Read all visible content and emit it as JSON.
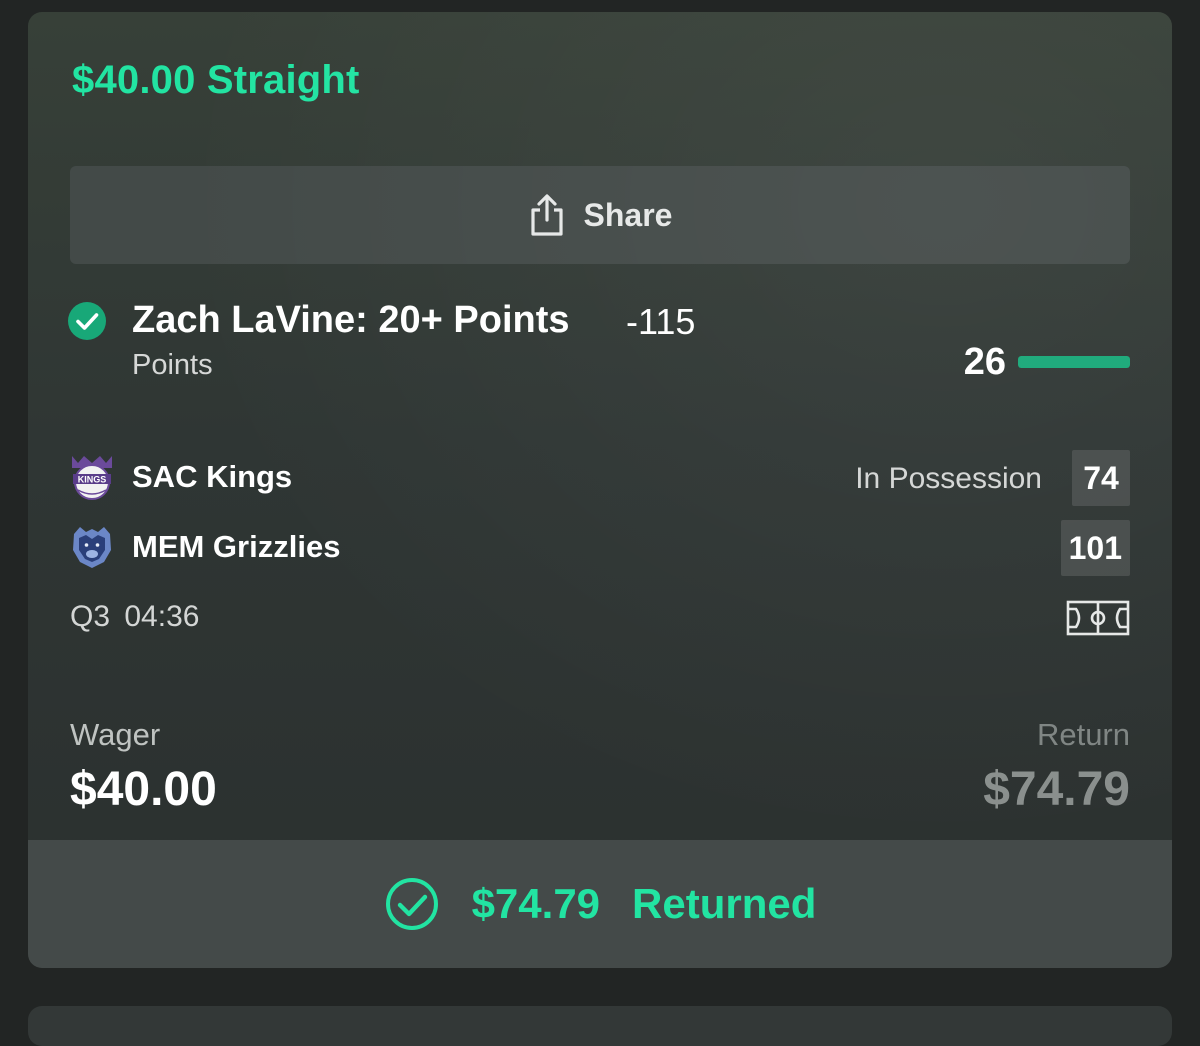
{
  "bet": {
    "title": "$40.00 Straight"
  },
  "share": {
    "label": "Share",
    "icon": "share-icon"
  },
  "selection": {
    "status_icon": "check-circle-icon",
    "name": "Zach LaVine: 20+ Points",
    "odds": "-115",
    "market": "Points",
    "stat_value": "26",
    "progress_fraction": 1.0
  },
  "game": {
    "teams": [
      {
        "name": "SAC Kings",
        "logo_icon": "kings-logo-icon",
        "possession_text": "In Possession",
        "score": "74"
      },
      {
        "name": "MEM Grizzlies",
        "logo_icon": "grizzlies-logo-icon",
        "possession_text": "",
        "score": "101"
      }
    ],
    "period": "Q3",
    "clock": "04:36",
    "court_icon": "court-icon"
  },
  "wager": {
    "label": "Wager",
    "value": "$40.00"
  },
  "return": {
    "label": "Return",
    "value": "$74.79"
  },
  "result": {
    "icon": "check-circle-icon",
    "amount": "$74.79",
    "text": "Returned"
  },
  "colors": {
    "accent": "#22e4a2",
    "progress": "#18a878",
    "card_bg": "#2f3634",
    "page_bg": "#222524"
  }
}
